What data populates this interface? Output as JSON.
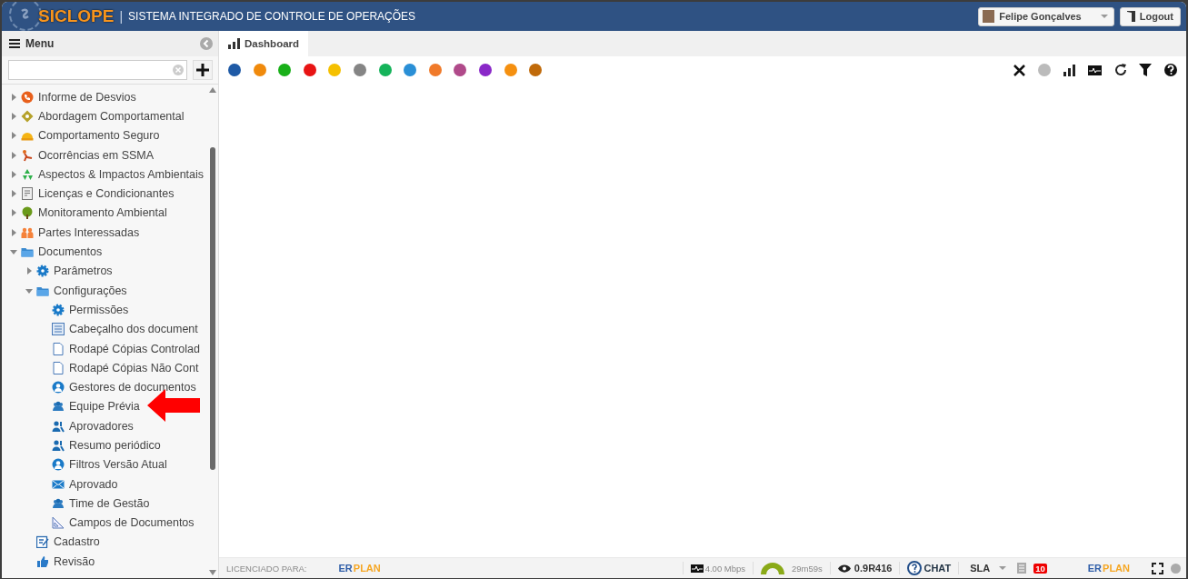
{
  "header": {
    "brand": "SICLOPE",
    "separator": "|",
    "title": "SISTEMA INTEGRADO DE CONTROLE DE OPERAÇÕES",
    "user": "Felipe Gonçalves",
    "logout": "Logout"
  },
  "sidebar": {
    "title": "Menu",
    "tree": [
      {
        "label": "Informe de Desvios",
        "kind": "phone",
        "expanded": false
      },
      {
        "label": "Abordagem Comportamental",
        "kind": "diamond",
        "expanded": false
      },
      {
        "label": "Comportamento Seguro",
        "kind": "helmet",
        "expanded": false
      },
      {
        "label": "Ocorrências em SSMA",
        "kind": "fall",
        "expanded": false
      },
      {
        "label": "Aspectos & Impactos Ambientais",
        "kind": "recycle",
        "expanded": false
      },
      {
        "label": "Licenças e Condicionantes",
        "kind": "certificate",
        "expanded": false
      },
      {
        "label": "Monitoramento Ambiental",
        "kind": "tree",
        "expanded": false
      },
      {
        "label": "Partes Interessadas",
        "kind": "people",
        "expanded": false
      },
      {
        "label": "Documentos",
        "kind": "folder",
        "expanded": true,
        "children": [
          {
            "label": "Parâmetros",
            "kind": "gear",
            "expanded": false
          },
          {
            "label": "Configurações",
            "kind": "folder",
            "expanded": true,
            "children": [
              {
                "label": "Permissões",
                "kind": "gear"
              },
              {
                "label": "Cabeçalho dos document",
                "kind": "form"
              },
              {
                "label": "Rodapé Cópias Controlad",
                "kind": "page"
              },
              {
                "label": "Rodapé Cópias Não Cont",
                "kind": "page"
              },
              {
                "label": "Gestores de documentos",
                "kind": "user"
              },
              {
                "label": "Equipe Prévia",
                "kind": "group"
              },
              {
                "label": "Aprovadores",
                "kind": "users"
              },
              {
                "label": "Resumo periódico",
                "kind": "users"
              },
              {
                "label": "Filtros Versão Atual",
                "kind": "user"
              },
              {
                "label": "Aprovado",
                "kind": "mail"
              },
              {
                "label": "Time de Gestão",
                "kind": "group"
              },
              {
                "label": "Campos de Documentos",
                "kind": "ruler"
              }
            ]
          },
          {
            "label": "Cadastro",
            "kind": "edit"
          },
          {
            "label": "Revisão",
            "kind": "thumb"
          }
        ]
      }
    ]
  },
  "tabs": [
    {
      "label": "Dashboard",
      "selected": true
    }
  ],
  "color_filters": [
    {
      "color": "#1f5aa6"
    },
    {
      "color": "#f08a0c"
    },
    {
      "color": "#19b019"
    },
    {
      "color": "#e81414"
    },
    {
      "color": "#f5c000"
    },
    {
      "color": "#858585"
    },
    {
      "color": "#15b35a"
    },
    {
      "color": "#2a8fd6"
    },
    {
      "color": "#f07a2a"
    },
    {
      "color": "#b04a8a"
    },
    {
      "color": "#8a28c8"
    },
    {
      "color": "#f59010"
    },
    {
      "color": "#c06a0a"
    }
  ],
  "footer": {
    "licensed_label": "LICENCIADO PARA:",
    "licensee_logo": [
      {
        "text": "ER",
        "color": "#2f5ea8"
      },
      {
        "text": "PLAN",
        "color": "#f5a623"
      }
    ],
    "company_logo": [
      {
        "text": "ER",
        "color": "#2f5ea8"
      },
      {
        "text": "PLAN",
        "color": "#f5a623"
      }
    ],
    "speed": "4.00 Mbps",
    "session_time": "29m59s",
    "version": "0.9R416",
    "chat": "CHAT",
    "sla": "SLA",
    "notifications": "10"
  }
}
